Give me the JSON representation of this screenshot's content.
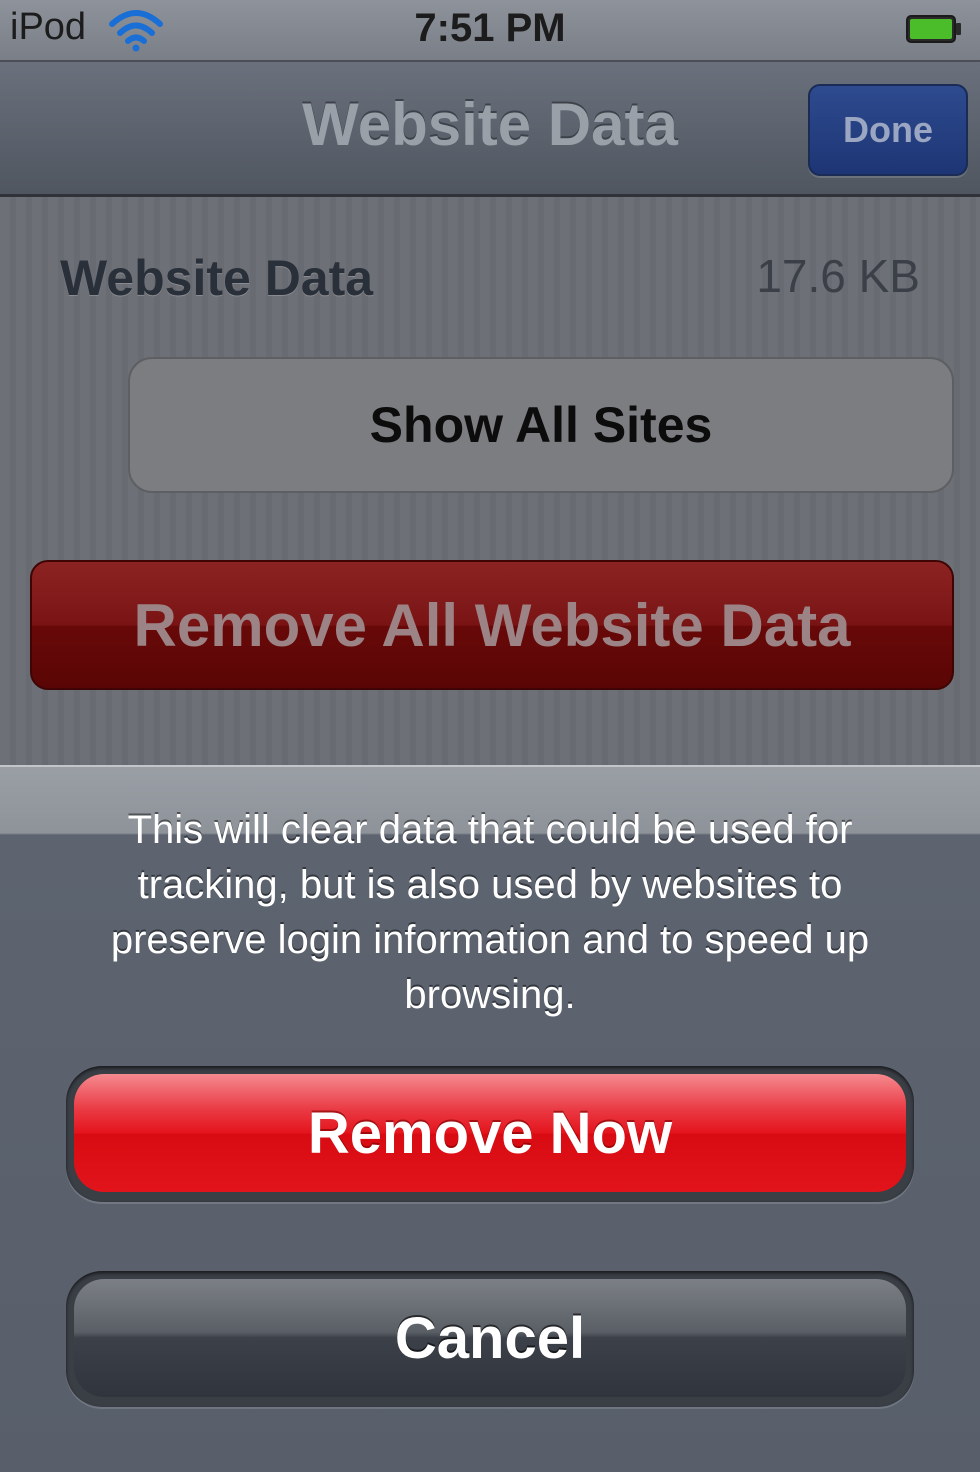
{
  "status_bar": {
    "carrier": "iPod",
    "time": "7:51 PM",
    "wifi_icon": "wifi-icon",
    "battery_icon": "battery-icon"
  },
  "nav": {
    "title": "Website Data",
    "done_label": "Done"
  },
  "content": {
    "website_data_label": "Website Data",
    "website_data_size": "17.6 KB",
    "show_all_sites_label": "Show All Sites",
    "remove_all_label": "Remove All Website Data"
  },
  "action_sheet": {
    "message": "This will clear data that could be used for tracking, but is also used by websites to preserve login information and to speed up browsing.",
    "remove_now_label": "Remove Now",
    "cancel_label": "Cancel"
  },
  "colors": {
    "destructive": "#e4141c",
    "nav_accent": "#1d3574"
  }
}
